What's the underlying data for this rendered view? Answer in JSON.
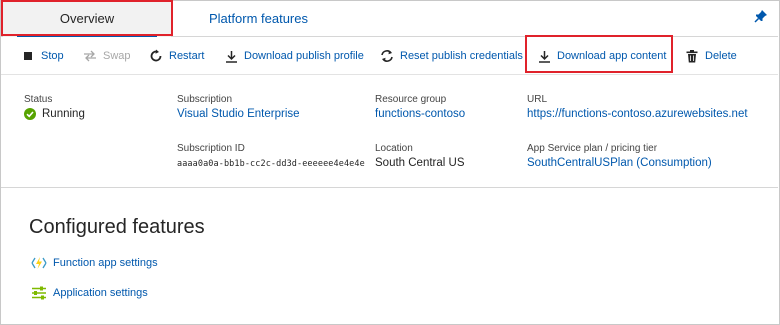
{
  "tabs": [
    {
      "label": "Overview",
      "active": true
    },
    {
      "label": "Platform features",
      "active": false
    }
  ],
  "toolbar": {
    "stop": "Stop",
    "swap": "Swap",
    "restart": "Restart",
    "download_profile": "Download publish profile",
    "reset_credentials": "Reset publish credentials",
    "download_content": "Download app content",
    "delete": "Delete"
  },
  "essentials": {
    "status": {
      "label": "Status",
      "value": "Running"
    },
    "subscription": {
      "label": "Subscription",
      "value": "Visual Studio Enterprise"
    },
    "subscription_id": {
      "label": "Subscription ID",
      "value": "aaaa0a0a-bb1b-cc2c-dd3d-eeeeee4e4e4e"
    },
    "resource_group": {
      "label": "Resource group",
      "value": "functions-contoso"
    },
    "location": {
      "label": "Location",
      "value": "South Central US"
    },
    "url": {
      "label": "URL",
      "value": "https://functions-contoso.azurewebsites.net"
    },
    "plan": {
      "label": "App Service plan / pricing tier",
      "value": "SouthCentralUSPlan (Consumption)"
    }
  },
  "configured": {
    "title": "Configured features",
    "items": [
      {
        "label": "Function app settings",
        "icon": "lightning-icon"
      },
      {
        "label": "Application settings",
        "icon": "settings-sliders-icon"
      }
    ]
  },
  "colors": {
    "link": "#0058ad",
    "highlight": "#e0222b",
    "running": "#57a300",
    "disabled": "#a7a7a7"
  }
}
